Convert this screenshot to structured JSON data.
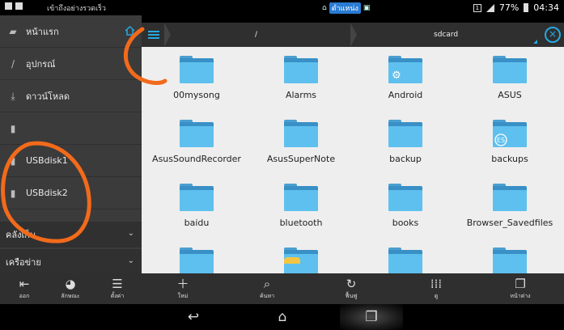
{
  "status_bar": {
    "ticker": "เข้าถึงอย่างรวดเร็ว",
    "mid_label": "ตำแหน่ง",
    "notify": "1",
    "battery": "77%",
    "time": "04:34"
  },
  "sidebar": {
    "items": [
      {
        "label": "หน้าแรก",
        "icon": "folder-home-icon"
      },
      {
        "label": "อุปกรณ์",
        "icon": "slash-device-icon"
      },
      {
        "label": "ดาวน์โหลด",
        "icon": "download-icon"
      },
      {
        "label": "",
        "icon": "sdcard-icon"
      },
      {
        "label": "USBdisk1",
        "icon": "usb-icon"
      },
      {
        "label": "USBdisk2",
        "icon": "usb-icon"
      }
    ],
    "sections": [
      {
        "label": "คลังเก็บ"
      },
      {
        "label": "เครือข่าย"
      }
    ]
  },
  "toolbar": {
    "crumbs": [
      "/",
      "sdcard"
    ]
  },
  "folders": [
    {
      "name": "00mysong",
      "badge": ""
    },
    {
      "name": "Alarms",
      "badge": ""
    },
    {
      "name": "Android",
      "badge": "gear"
    },
    {
      "name": "ASUS",
      "badge": ""
    },
    {
      "name": "AsusSoundRecorder",
      "badge": ""
    },
    {
      "name": "AsusSuperNote",
      "badge": ""
    },
    {
      "name": "backup",
      "badge": ""
    },
    {
      "name": "backups",
      "badge": "ES"
    },
    {
      "name": "baidu",
      "badge": ""
    },
    {
      "name": "bluetooth",
      "badge": ""
    },
    {
      "name": "books",
      "badge": ""
    },
    {
      "name": "Browser_Savedfiles",
      "badge": ""
    }
  ],
  "action_bar": {
    "left": [
      {
        "label": "ออก",
        "icon": "exit-icon"
      },
      {
        "label": "ลักษณะ",
        "icon": "theme-icon"
      },
      {
        "label": "ตั้งค่า",
        "icon": "settings-sliders-icon"
      }
    ],
    "right": [
      {
        "label": "ใหม่",
        "icon": "plus-icon"
      },
      {
        "label": "ค้นหา",
        "icon": "search-icon"
      },
      {
        "label": "ฟื้นฟู",
        "icon": "refresh-icon"
      },
      {
        "label": "ดู",
        "icon": "grid-view-icon"
      },
      {
        "label": "หน้าต่าง",
        "icon": "windows-icon"
      }
    ]
  },
  "colors": {
    "accent": "#27a9e3",
    "folder": "#5ec0ee",
    "annotation": "#f26a1b"
  }
}
